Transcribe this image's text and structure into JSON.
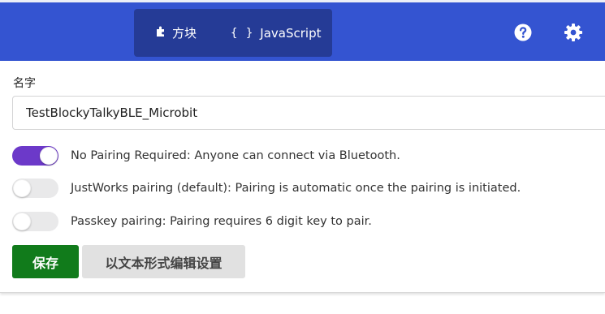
{
  "header": {
    "tabs": [
      {
        "label": "方块",
        "icon": "puzzle-icon",
        "selected": false
      },
      {
        "label": "JavaScript",
        "icon": "braces-icon",
        "selected": false
      }
    ],
    "braces_glyph": "{ }",
    "help_icon": "help-icon",
    "settings_icon": "gear-icon",
    "colors": {
      "bar": "#3454d1",
      "toggle_group": "#253b96"
    }
  },
  "form": {
    "name_label": "名字",
    "name_value": "TestBlockyTalkyBLE_Microbit",
    "options": [
      {
        "label": "No Pairing Required: Anyone can connect via Bluetooth.",
        "enabled": true
      },
      {
        "label": "JustWorks pairing (default): Pairing is automatic once the pairing is initiated.",
        "enabled": false
      },
      {
        "label": "Passkey pairing: Pairing requires 6 digit key to pair.",
        "enabled": false
      }
    ],
    "save_label": "保存",
    "edit_as_text_label": "以文本形式编辑设置",
    "colors": {
      "toggle_on": "#6c39c9",
      "save_button": "#117b1b",
      "secondary_button": "#e1e1e1"
    }
  }
}
